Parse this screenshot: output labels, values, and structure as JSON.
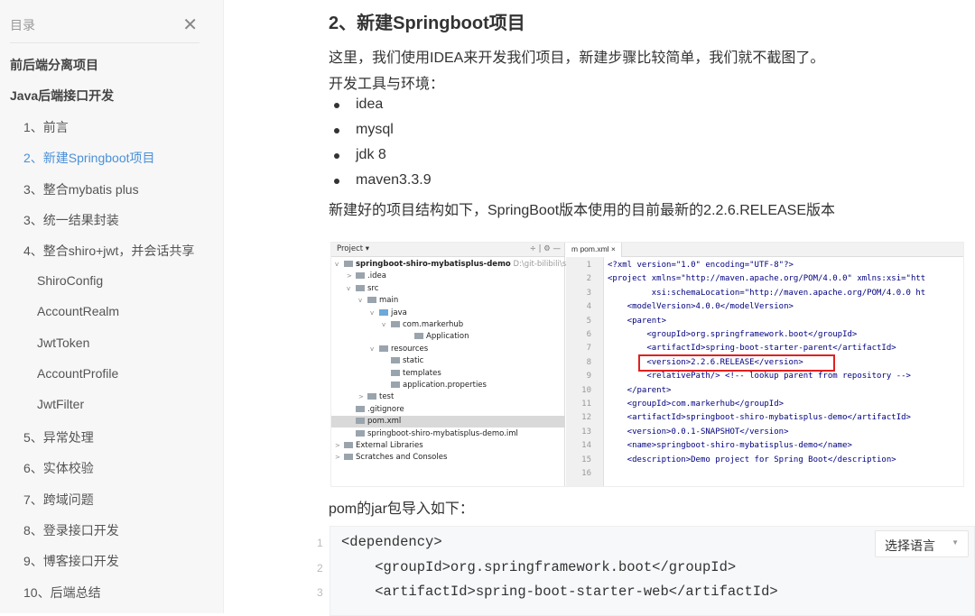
{
  "toc": {
    "title": "目录",
    "close_icon": "close-icon",
    "items": [
      {
        "label": "前后端分离项目",
        "level": 0
      },
      {
        "label": "Java后端接口开发",
        "level": 0
      },
      {
        "label": "1、前言",
        "level": 1
      },
      {
        "label": "2、新建Springboot项目",
        "level": 1,
        "active": true
      },
      {
        "label": "3、整合mybatis plus",
        "level": 1
      },
      {
        "label": "3、统一结果封装",
        "level": 1
      },
      {
        "label": "4、整合shiro+jwt，并会话共享",
        "level": 1
      },
      {
        "label": "ShiroConfig",
        "level": 2
      },
      {
        "label": "AccountRealm",
        "level": 2
      },
      {
        "label": "JwtToken",
        "level": 2
      },
      {
        "label": "AccountProfile",
        "level": 2
      },
      {
        "label": "JwtFilter",
        "level": 2
      },
      {
        "label": "5、异常处理",
        "level": 1
      },
      {
        "label": "6、实体校验",
        "level": 1
      },
      {
        "label": "7、跨域问题",
        "level": 1
      },
      {
        "label": "8、登录接口开发",
        "level": 1
      },
      {
        "label": "9、博客接口开发",
        "level": 1
      },
      {
        "label": "10、后端总结",
        "level": 1
      }
    ]
  },
  "article": {
    "heading": "2、新建Springboot项目",
    "intro": "这里，我们使用IDEA来开发我们项目，新建步骤比较简单，我们就不截图了。",
    "env_label": "开发工具与环境：",
    "env": [
      "idea",
      "mysql",
      "jdk 8",
      "maven3.3.9"
    ],
    "structure_text": "新建好的项目结构如下，SpringBoot版本使用的目前最新的2.2.6.RELEASE版本",
    "pom_text": "pom的jar包导入如下：",
    "accent": "#4a90d9"
  },
  "ide": {
    "project_label": "Project ▾",
    "toolbar": "÷ | ⚙ —",
    "tree": [
      {
        "label": "springboot-shiro-mybatisplus-demo",
        "hint": "D:\\git-bilibili\\spring",
        "depth": 0,
        "arrow": "v",
        "bold": true
      },
      {
        "label": ".idea",
        "depth": 1,
        "arrow": ">"
      },
      {
        "label": "src",
        "depth": 1,
        "arrow": "v"
      },
      {
        "label": "main",
        "depth": 2,
        "arrow": "v"
      },
      {
        "label": "java",
        "depth": 3,
        "arrow": "v",
        "blue": true
      },
      {
        "label": "com.markerhub",
        "depth": 4,
        "arrow": "v"
      },
      {
        "label": "Application",
        "depth": 6,
        "arrow": ""
      },
      {
        "label": "resources",
        "depth": 3,
        "arrow": "v"
      },
      {
        "label": "static",
        "depth": 4,
        "arrow": ""
      },
      {
        "label": "templates",
        "depth": 4,
        "arrow": ""
      },
      {
        "label": "application.properties",
        "depth": 4,
        "arrow": ""
      },
      {
        "label": "test",
        "depth": 2,
        "arrow": ">"
      },
      {
        "label": ".gitignore",
        "depth": 1,
        "arrow": ""
      },
      {
        "label": "pom.xml",
        "depth": 1,
        "arrow": "",
        "selected": true
      },
      {
        "label": "springboot-shiro-mybatisplus-demo.iml",
        "depth": 1,
        "arrow": ""
      },
      {
        "label": "External Libraries",
        "depth": 0,
        "arrow": ">"
      },
      {
        "label": "Scratches and Consoles",
        "depth": 0,
        "arrow": ">"
      }
    ],
    "tab": "m pom.xml ×",
    "lines": [
      "<?xml version=\"1.0\" encoding=\"UTF-8\"?>",
      "<project xmlns=\"http://maven.apache.org/POM/4.0.0\" xmlns:xsi=\"htt",
      "         xsi:schemaLocation=\"http://maven.apache.org/POM/4.0.0 ht",
      "    <modelVersion>4.0.0</modelVersion>",
      "    <parent>",
      "        <groupId>org.springframework.boot</groupId>",
      "        <artifactId>spring-boot-starter-parent</artifactId>",
      "        <version>2.2.6.RELEASE</version>",
      "        <relativePath/> <!-- lookup parent from repository -->",
      "    </parent>",
      "    <groupId>com.markerhub</groupId>",
      "    <artifactId>springboot-shiro-mybatisplus-demo</artifactId>",
      "    <version>0.0.1-SNAPSHOT</version>",
      "    <name>springboot-shiro-mybatisplus-demo</name>",
      "    <description>Demo project for Spring Boot</description>",
      ""
    ]
  },
  "code": {
    "lang_button": "选择语言",
    "lines": [
      "<dependency>",
      "    <groupId>org.springframework.boot</groupId>",
      "    <artifactId>spring-boot-starter-web</artifactId>"
    ]
  }
}
